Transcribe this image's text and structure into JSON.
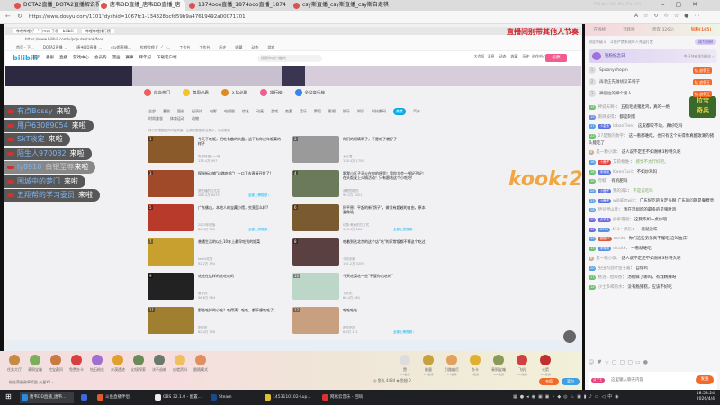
{
  "browser": {
    "tabs": [
      {
        "label": "DOTA2直播_DOTA2直播解说视频_"
      },
      {
        "label": "唐韦DD直播_唐韦DD直播_唐"
      },
      {
        "label": "1874ooo直播_1874ooo直播_1874"
      },
      {
        "label": "csy斯直播_csy斯直播_csy斯自走棋"
      }
    ],
    "url": "https://www.douyu.com/1101?dyshid=1067fc1-134328bcfd59b9a47619492a00071701",
    "sysstats": "FPS N/A   GPU 8%   CPU 11%"
  },
  "stream": {
    "overlay_title": "直播间别带其他人节奏",
    "kook_logo": "kook:212",
    "inner_browser": {
      "tabs": [
        "哔哩哔哩 (゜-゜)つロ 干杯~-bilibili",
        "哔哩哔哩排行榜"
      ],
      "url": "https://www.bilibili.com/v/popular/rank/food",
      "bookmarks": [
        "首页 - 下...",
        "DOTA2直播_...",
        "唐韦DD直播_...",
        "csy斯直播...",
        "哔哩哔哩 (゜-゜)...",
        "工作台",
        "工作台",
        "历史",
        "收藏",
        "动态",
        "游戏"
      ],
      "logo": "bilibili",
      "nav": [
        "首页",
        "番剧",
        "直播",
        "游戏中心",
        "会员购",
        "漫画",
        "赛事",
        "拜年纪",
        "下载客户端"
      ],
      "search_placeholder": "搜索你感兴趣的",
      "header_icons": [
        "大会员",
        "消息",
        "动态",
        "收藏",
        "历史",
        "创作中心"
      ],
      "upload": "投稿",
      "categories": [
        {
          "label": "综合热门",
          "color": "#f25d5d"
        },
        {
          "label": "每周必看",
          "color": "#f2c230"
        },
        {
          "label": "入站必刷",
          "color": "#e08a20"
        },
        {
          "label": "排行榜",
          "color": "#f25d8e"
        },
        {
          "label": "全站音乐榜",
          "color": "#3a86e6"
        }
      ],
      "filters": [
        "全部",
        "番剧",
        "国创",
        "纪录片",
        "电影",
        "电视剧",
        "综艺",
        "动画",
        "游戏",
        "鬼畜",
        "音乐",
        "舞蹈",
        "影视",
        "娱乐",
        "知识",
        "科技数码",
        "美食",
        "汽车",
        "时尚美妆",
        "体育运动",
        "动物"
      ],
      "selected_filter": "美食",
      "notice": "排行榜根据稿件内容质量、近期的数据综合展示，动态更新",
      "more_label": "全部上榜视频 ›",
      "items": [
        {
          "rank": "1",
          "title": "今天不吃饭，把吃有趣的大盘，这下有你过年饭菜的样子",
          "up": "吃货阿福一一号",
          "stats": "135.4万   497",
          "color": "#8a5a2a"
        },
        {
          "rank": "2",
          "title": "你们的眼睛啊了，不是吃了就好了～",
          "up": "水瓜君",
          "stats": "128.4万   1709",
          "color": "#9a9a9a"
        },
        {
          "rank": "3",
          "title": "探秘街边摊\"边路吃啥\"！一口下去直接开饭了!",
          "up": "夏吃播的达达生",
          "stats": "286.4万   6473",
          "color": "#a04a2a"
        },
        {
          "rank": "4",
          "title": "跟我小区子灵火在你的杯里！看你大会一顿好不好！在头饭桌上火锅活动！只有跟着这个小吃吧!",
          "up": "我是勤勤的",
          "stats": "96.2万   3421",
          "color": "#6a7a5a"
        },
        {
          "rank": "5",
          "title": "广东佛山，本地人的宝藏小馆，究竟怎么样?",
          "up": "2023年的饭",
          "stats": "80.4万   561",
          "color": "#b83a2a"
        },
        {
          "rank": "6",
          "title": "科平原：平起的新\"鸽子\"，做法有超越的自由，原本要做啥",
          "up": "记录·美食的方方式",
          "stats": "136.4万   286",
          "color": "#7a5a30"
        },
        {
          "rank": "7",
          "title": "普通生活的以上10年上最早吃到的饭菜",
          "up": "kevin吃货",
          "stats": "92.2万   394",
          "color": "#c8a030"
        },
        {
          "rank": "8",
          "title": "吃着到达北京的这个店\"吃\"的家常饭都不够这个吃过",
          "up": "今吃到我",
          "stats": "101.2万   3259",
          "color": "#5a4040"
        },
        {
          "rank": "9",
          "title": "吃吃在这样的吃吃吃的",
          "up": "看你的",
          "stats": "56.6万   964",
          "color": "#222"
        },
        {
          "rank": "10",
          "title": "今天吃菜吃一些\"不管你出吃的\"",
          "up": "今天吃",
          "stats": "68.4万   681",
          "color": "#bcd6c8"
        },
        {
          "rank": "11",
          "title": "那些吃好的小吃？吃得满：吃吃，都不想吃吃了。",
          "up": "吃吃吃",
          "stats": "82.4万   756",
          "color": "#a08030"
        },
        {
          "rank": "12",
          "title": "吃吃吃吃",
          "up": "吃吃吃吃",
          "stats": "6.6万   121",
          "color": "#c8a080"
        }
      ]
    },
    "entries": [
      {
        "name": "有点Bossy",
        "action": "来啦"
      },
      {
        "name": "用户63089054",
        "action": "来啦"
      },
      {
        "name": "SkT淡定",
        "action": "来啦"
      },
      {
        "name": "陌生人970082",
        "action": "来啦"
      },
      {
        "name": "ly8918",
        "title": "白银至尊",
        "action": "来啦"
      },
      {
        "name": "围城中的楚门",
        "action": "来啦"
      },
      {
        "name": "五翔帮的学习委员",
        "action": "来啦"
      }
    ]
  },
  "panel": {
    "tabs": [
      "在线榜",
      "活跃榜",
      "贵宾(3265)",
      "钻粉(165)"
    ],
    "active_tab": 3,
    "fan_level": "粉丝等级 ℹ",
    "fan_notice": "斗鱼严禁未成年人充值打赏",
    "fan_button": "成为钻粉",
    "anniversary": "钻粉纪念日",
    "anniversary_right": "今日共有4位粉丝 ›",
    "ranking": [
      {
        "n": "1",
        "name": "Spoonychopin",
        "tag": "钻 战争王"
      },
      {
        "n": "2",
        "name": "再老庄先做胡没羊帽子",
        "tag": "钻 战争王"
      },
      {
        "n": "3",
        "name": "神宿拉的神个男人",
        "tag": "钻 战争王"
      }
    ],
    "chat": [
      {
        "lv": "15",
        "lvc": "#6cc16c",
        "user": "神说天啊-",
        "text": "五指毛桃猪肚鸡，真的一绝"
      },
      {
        "lv": "15",
        "lvc": "#6a8ae0",
        "user": "南目彼得",
        "text": "都是刺客"
      },
      {
        "lv": "17",
        "lvc": "#5aa0e0",
        "fan": "小金鱼",
        "fanc": "#5a70e0",
        "user": "labanTlee",
        "text": "这皮都咬不动，真好吃吗"
      },
      {
        "lv": "22",
        "lvc": "#6cc16c",
        "user": "27是我的数字",
        "text": "这一看都难吃，也只有这个长得像真酷歌潮的猪头能吃了"
      },
      {
        "lv": "8",
        "lvc": "#c8b090",
        "user": "是一颗小歌",
        "text": "这人说不定还不如谢彬3秒特久呢"
      },
      {
        "lv": "16",
        "lvc": "#5aa0e0",
        "fan": "小鹿梦",
        "fanc": "#e04040",
        "user": "艾莉希维-",
        "text": "感觉不太行好吧。",
        "hl": true
      },
      {
        "lv": "18",
        "lvc": "#6cc16c",
        "fan": "深深痕",
        "fanc": "#5a70e0",
        "user": "KwenTusi",
        "text": "不如炒鸡吗"
      },
      {
        "lv": "10",
        "lvc": "#6cc16c",
        "user": "夸鲸",
        "text": "有机肥吗"
      },
      {
        "lv": "20",
        "lvc": "#5aa0e0",
        "fan": "小鹿梦",
        "fanc": "#5a70e0",
        "user": "我的海1",
        "text": "不是说吃吗",
        "hl": true
      },
      {
        "lv": "23",
        "lvc": "#5aa0e0",
        "fan": "小鹿梦",
        "fanc": "#5a70e0",
        "user": "will威尔will",
        "text": "广东好吃的肯定多啊 广东的问题是餐费贵"
      },
      {
        "lv": "28",
        "lvc": "#5aa0e0",
        "user": "伊豆野山菱",
        "text": "我在深圳吃的最多的是猪肚鸡"
      },
      {
        "lv": "40",
        "lvc": "#6a6ae0",
        "fan": "点子王",
        "fanc": "#6a6ae0",
        "user": "护手霜凝",
        "text": "这我不如一桌炒吧"
      },
      {
        "lv": "40",
        "lvc": "#6a6ae0",
        "fan": "CSTG",
        "fanc": "#5a90e0",
        "user": "413丶燃乐",
        "text": "一看就没味"
      },
      {
        "lv": "16",
        "lvc": "#5aa0e0",
        "fan": "猫猫EF",
        "fanc": "#e05a3a",
        "user": "zonit",
        "text": "你们这些弟弟真不懂吃 这叫血沫?"
      },
      {
        "lv": "13",
        "lvc": "#6cc16c",
        "fan": "深深痕",
        "fanc": "#5a90e0",
        "user": "dicckk",
        "text": "一看就难吃"
      },
      {
        "lv": "8",
        "lvc": "#c8b090",
        "user": "是一颗小歌",
        "text": "这人说不定还不如谢彬3秒特久呢"
      },
      {
        "lv": "20",
        "lvc": "#5aa0e0",
        "user": "虫虫的酒叶鱼子酱",
        "text": "自熔鸡"
      },
      {
        "lv": "17",
        "lvc": "#6cc16c",
        "user": "桃浴...给眼香",
        "text": "汤很鲜了哪吗，有戏精辣呀"
      },
      {
        "lv": "14",
        "lvc": "#6cc16c",
        "user": "沙士多喝热水",
        "text": "没有脆猪糕，应该不好吃"
      }
    ],
    "input_placeholder": "这里输入聊天内容",
    "my_tag": "点子王",
    "send": "发送"
  },
  "giftbar": {
    "left_items": [
      "任务大厅",
      "青铜宝箱",
      "挖宝藏问",
      "免费办卡",
      "钻石粉丝",
      "沙漠遗迹",
      "幻境探索",
      "决不退缩",
      "成就资料",
      "跟随模式"
    ],
    "fan_wall": "粉丝荣誉勋章奖励  火星X1 ›",
    "gifts": [
      {
        "name": "赞",
        "price": "0.1鱼翅"
      },
      {
        "name": "能量",
        "price": "0.2鱼翅"
      },
      {
        "name": "引路幽灯",
        "price": "0.5鱼翅"
      },
      {
        "name": "办卡",
        "price": "6鱼翅"
      },
      {
        "name": "青铜宝箱",
        "price": "100鱼翅"
      },
      {
        "name": "飞机",
        "price": "100鱼翅"
      },
      {
        "name": "火箭",
        "price": "500鱼翅"
      }
    ],
    "balance": "◎ 鱼丸 4484   ◈ 鱼翅 0",
    "recharge": "充值",
    "backpack": "背包"
  },
  "taskbar": {
    "items": [
      "唐韦DD直播_唐韦...",
      "",
      "斗鱼直播伴侣",
      "OBS 32.1.0 - 配置...",
      "Steam",
      "1453110102-Lup...",
      "网易云音乐 - 回响"
    ],
    "time": "18:53:24",
    "date": "2026/4/4"
  }
}
